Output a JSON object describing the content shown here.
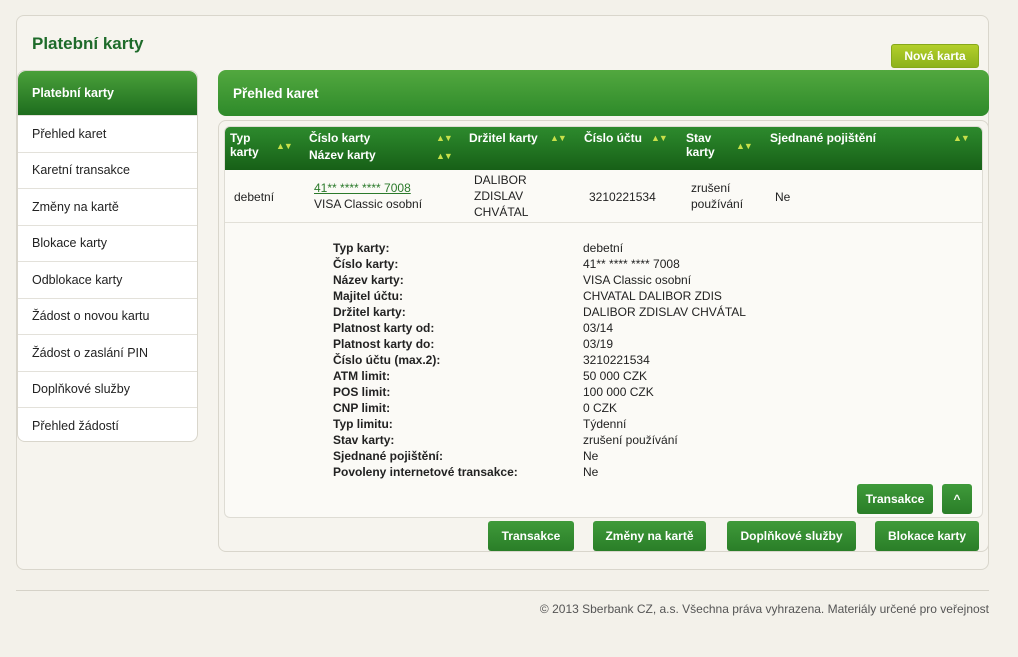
{
  "page_title": "Platební karty",
  "new_card_button": "Nová karta",
  "sidebar": {
    "header": "Platební karty",
    "items": [
      "Přehled karet",
      "Karetní transakce",
      "Změny na kartě",
      "Blokace karty",
      "Odblokace karty",
      "Žádost o novou kartu",
      "Žádost o zaslání PIN",
      "Doplňkové služby",
      "Přehled žádostí"
    ]
  },
  "main_title": "Přehled karet",
  "table": {
    "headers": {
      "typ": [
        "Typ",
        "karty"
      ],
      "cislo": [
        "Číslo karty",
        "Název karty"
      ],
      "drzitel": "Držitel karty",
      "ucet": "Číslo účtu",
      "stav": [
        "Stav",
        "karty"
      ],
      "pojisteni": "Sjednané pojištění"
    },
    "row": {
      "typ": "debetní",
      "cislo": "41** **** **** 7008",
      "nazev": "VISA Classic osobní",
      "drzitel": [
        "DALIBOR",
        "ZDISLAV",
        "CHVÁTAL"
      ],
      "ucet": "3210221534",
      "stav": [
        "zrušení",
        "používání"
      ],
      "pojisteni": "Ne"
    }
  },
  "detail": [
    {
      "label": "Typ karty:",
      "value": "debetní"
    },
    {
      "label": "Číslo karty:",
      "value": "41** **** **** 7008"
    },
    {
      "label": "Název karty:",
      "value": "VISA Classic osobní"
    },
    {
      "label": "Majitel účtu:",
      "value": "CHVATAL DALIBOR ZDIS"
    },
    {
      "label": "Držitel karty:",
      "value": "DALIBOR ZDISLAV CHVÁTAL"
    },
    {
      "label": "Platnost karty od:",
      "value": "03/14"
    },
    {
      "label": "Platnost karty do:",
      "value": "03/19"
    },
    {
      "label": "Číslo účtu (max.2):",
      "value": "3210221534"
    },
    {
      "label": "ATM limit:",
      "value": "50 000 CZK"
    },
    {
      "label": "POS limit:",
      "value": "100 000 CZK"
    },
    {
      "label": "CNP limit:",
      "value": "0 CZK"
    },
    {
      "label": "Typ limitu:",
      "value": "Týdenní"
    },
    {
      "label": "Stav karty:",
      "value": "zrušení používání"
    },
    {
      "label": "Sjednané pojištění:",
      "value": "Ne"
    },
    {
      "label": "Povoleny internetové transakce:",
      "value": "Ne"
    }
  ],
  "detail_buttons": {
    "transakce": "Transakce",
    "collapse": "^"
  },
  "bottom_buttons": {
    "transakce": "Transakce",
    "zmeny": "Změny na kartě",
    "doplnkove": "Doplňkové služby",
    "blokace": "Blokace karty"
  },
  "footer": "© 2013 Sberbank CZ, a.s. Všechna práva vyhrazena. Materiály určené pro veřejnost",
  "colors": {
    "brand_green": "#2e8a2a",
    "accent_lime": "#a4c424"
  }
}
